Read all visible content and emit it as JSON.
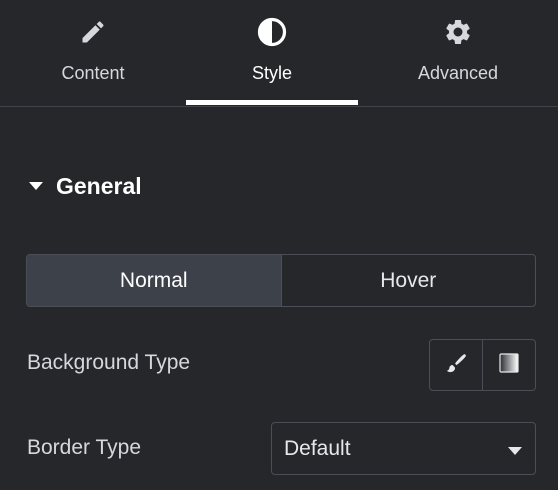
{
  "tabs": [
    {
      "label": "Content",
      "icon": "pencil-icon"
    },
    {
      "label": "Style",
      "icon": "contrast-icon",
      "active": true
    },
    {
      "label": "Advanced",
      "icon": "gear-icon"
    }
  ],
  "section": {
    "title": "General",
    "expanded": true
  },
  "state_toggle": {
    "options": [
      "Normal",
      "Hover"
    ],
    "selected": "Normal"
  },
  "background_type": {
    "label": "Background Type",
    "choices": [
      {
        "icon": "brush-icon"
      },
      {
        "icon": "gradient-icon"
      }
    ]
  },
  "border_type": {
    "label": "Border Type",
    "value": "Default"
  },
  "colors": {
    "panel_bg": "#26272b",
    "active_tab_indicator": "#ffffff",
    "active_state_bg": "#3d4149",
    "border": "#4a4f57"
  }
}
